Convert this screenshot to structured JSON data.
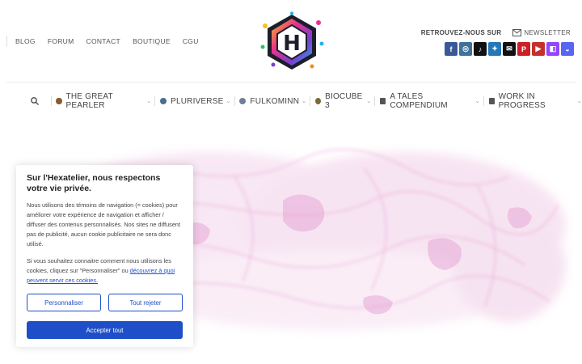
{
  "top_nav": {
    "items": [
      "BLOG",
      "FORUM",
      "CONTACT",
      "BOUTIQUE",
      "CGU"
    ]
  },
  "logo": {
    "letter": "H"
  },
  "follow": {
    "label": "RETROUVEZ-NOUS SUR",
    "newsletter": "NEWSLETTER"
  },
  "socials": [
    {
      "name": "facebook-icon",
      "glyph": "f",
      "color": "#3b5998"
    },
    {
      "name": "instagram-icon",
      "glyph": "◎",
      "color": "#3f729b"
    },
    {
      "name": "tiktok-icon",
      "glyph": "♪",
      "color": "#111111"
    },
    {
      "name": "twitter-icon",
      "glyph": "✦",
      "color": "#2478ba"
    },
    {
      "name": "email-icon",
      "glyph": "✉",
      "color": "#111111"
    },
    {
      "name": "pinterest-icon",
      "glyph": "P",
      "color": "#cb2027"
    },
    {
      "name": "youtube-icon",
      "glyph": "▶",
      "color": "#c4302b"
    },
    {
      "name": "twitch-icon",
      "glyph": "◧",
      "color": "#9146ff"
    },
    {
      "name": "discord-icon",
      "glyph": "◒",
      "color": "#5865f2"
    }
  ],
  "main_nav": {
    "items": [
      {
        "label": "THE GREAT PEARLER",
        "icon_color": "#8a5a2b"
      },
      {
        "label": "PLURIVERSE",
        "icon_color": "#4a6f8a"
      },
      {
        "label": "FULKOMINN",
        "icon_color": "#6f7f9a"
      },
      {
        "label": "BIOCUBE 3",
        "icon_color": "#7a6a3a"
      },
      {
        "label": "A TALES COMPENDIUM",
        "icon_color": "#555555"
      },
      {
        "label": "WORK IN PROGRESS",
        "icon_color": "#555555"
      }
    ]
  },
  "cookie": {
    "title": "Sur l'Hexatelier, nous respectons votre vie privée.",
    "body": "Nous utilisons des témoins de navigation (= cookies) pour améliorer votre expérience de navigation et afficher / diffuser des contenus personnalisés. Nos sites ne diffusent pas de publicité, aucun cookie publicitaire ne sera donc utilisé.",
    "body2_prefix": "Si vous souhaitez connaitre comment nous utilisons les cookies, cliquez sur \"Personnaliser\" ou ",
    "body2_link": "découvrez à quoi peuvent servir ces cookies.",
    "customize": "Personnaliser",
    "reject": "Tout rejeter",
    "accept": "Accepter tout"
  },
  "colors": {
    "accent": "#1e4fc8",
    "hero_tint": "#e8a8d8"
  }
}
